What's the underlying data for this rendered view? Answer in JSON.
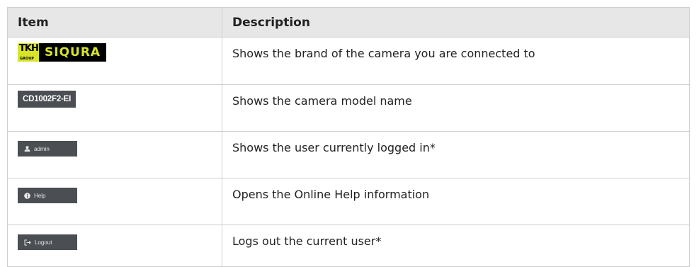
{
  "table": {
    "headers": [
      "Item",
      "Description"
    ],
    "rows": [
      {
        "item_type": "brand-logo",
        "logo_text": "SIQURA",
        "logo_prefix": "TKH",
        "logo_group": "GROUP",
        "description": "Shows the brand of the camera you are connected to"
      },
      {
        "item_type": "model-name",
        "label": "CD1002F2-EI",
        "description": "Shows the camera model name"
      },
      {
        "item_type": "user-button",
        "icon": "user-icon",
        "label": "admin",
        "description": "Shows the user currently logged in*"
      },
      {
        "item_type": "help-button",
        "icon": "info-icon",
        "label": "Help",
        "description": "Opens the Online Help information"
      },
      {
        "item_type": "logout-button",
        "icon": "logout-icon",
        "label": "Logout",
        "description": "Logs out the current user*"
      }
    ]
  },
  "colors": {
    "header_bg": "#e7e7e7",
    "button_bg": "#4b4f53",
    "brand_accent": "#d7e42a"
  }
}
